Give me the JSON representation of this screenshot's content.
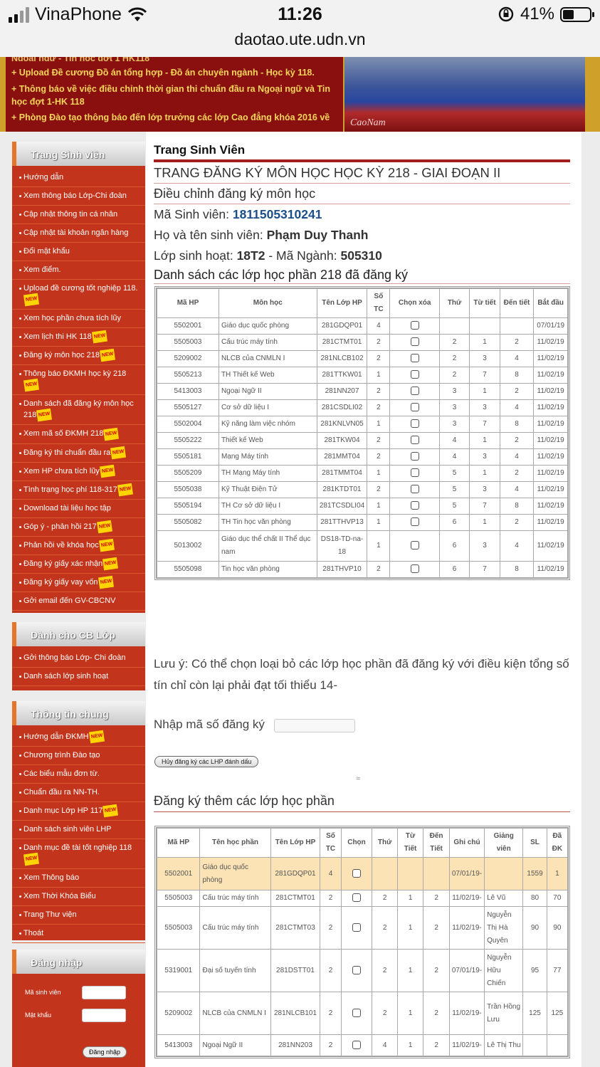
{
  "status": {
    "carrier": "VinaPhone",
    "time": "11:26",
    "battery": "41%",
    "battery_level": 0.41,
    "url": "daotao.ute.udn.vn"
  },
  "banner": {
    "news": [
      "Ngoại ngữ - Tin học đợt 1 HK118",
      "+ Upload Đề cương Đồ án tổng hợp - Đồ án chuyên ngành - Học kỳ 118.",
      "+ Thông báo về việc điều chỉnh thời gian thi chuẩn đầu ra Ngoại ngữ và Tin học đợt 1-HK 118",
      "+ Phòng Đào tạo thông báo đến lớp trưởng các lớp Cao đẳng khóa 2016 về"
    ],
    "signature": "CaoNam"
  },
  "sidebar": {
    "student": {
      "title": "Trang Sinh viên",
      "items": [
        {
          "label": "Hướng dẫn",
          "new": ""
        },
        {
          "label": "Xem thông báo Lớp-Chi đoàn",
          "new": ""
        },
        {
          "label": "Cập nhật thông tin cá nhân",
          "new": ""
        },
        {
          "label": "Cập nhật tài khoản ngân hàng",
          "new": ""
        },
        {
          "label": "Đổi mật khẩu",
          "new": ""
        },
        {
          "label": "Xem điểm.",
          "new": ""
        },
        {
          "label": "Upload đề cương tốt nghiệp 118.",
          "new": "NEW"
        },
        {
          "label": "Xem học phần chưa tích lũy",
          "new": ""
        },
        {
          "label": "Xem lịch thi HK 118",
          "new": "NEW"
        },
        {
          "label": "Đăng ký môn học 218",
          "new": "NEW"
        },
        {
          "label": "Thông báo ĐKMH học kỳ 218",
          "new": "NEW"
        },
        {
          "label": "Danh sách đã đăng ký môn học 218",
          "new": "NEW"
        },
        {
          "label": "Xem mã số ĐKMH 218",
          "new": "NEW"
        },
        {
          "label": "Đăng ký thi chuẩn đầu ra",
          "new": "NEW"
        },
        {
          "label": "Xem HP chưa tích lũy",
          "new": "NEW"
        },
        {
          "label": "Tình trạng học phí 118-317",
          "new": "NEW"
        },
        {
          "label": "Download tài liệu học tập",
          "new": ""
        },
        {
          "label": "Góp ý - phản hồi 217",
          "new": "NEW"
        },
        {
          "label": "Phản hồi về khóa học",
          "new": "NEW"
        },
        {
          "label": "Đăng ký giấy xác nhận",
          "new": "NEW"
        },
        {
          "label": "Đăng ký giấy vay vốn",
          "new": "NEW"
        },
        {
          "label": "Gởi email đến GV-CBCNV",
          "new": ""
        }
      ]
    },
    "cb": {
      "title": "Dành cho CB Lớp",
      "items": [
        {
          "label": "Gởi thông báo Lớp- Chi đoàn",
          "new": ""
        },
        {
          "label": "Danh sách lớp sinh hoạt",
          "new": ""
        }
      ]
    },
    "general": {
      "title": "Thông tin chung",
      "items": [
        {
          "label": "Hướng dẫn ĐKMH",
          "new": "NEW"
        },
        {
          "label": "Chương trình Đào tạo",
          "new": ""
        },
        {
          "label": "Các biểu mẫu đơn từ.",
          "new": ""
        },
        {
          "label": "Chuẩn đầu ra NN-TH.",
          "new": ""
        },
        {
          "label": "Danh mục Lớp HP 117",
          "new": "NEW"
        },
        {
          "label": "Danh sách sinh viên LHP",
          "new": ""
        },
        {
          "label": "Danh mục đề tài tốt nghiệp 118",
          "new": "NEW"
        },
        {
          "label": "Xem Thông báo",
          "new": ""
        },
        {
          "label": "Xem Thời Khóa Biểu",
          "new": ""
        },
        {
          "label": "Trang Thư viện",
          "new": ""
        },
        {
          "label": "Thoát",
          "new": ""
        }
      ]
    },
    "login": {
      "title": "Đăng nhập",
      "id_label": "Mã sinh viên",
      "pw_label": "Mật khẩu",
      "button": "Đăng nhập"
    }
  },
  "main": {
    "title": "Trang Sinh Viên",
    "subtitle": "TRANG ĐĂNG KÝ MÔN HỌC HỌC KỲ 218 - GIAI ĐOẠN II",
    "section": "Điều chỉnh đăng ký môn học",
    "student_id_label": "Mã Sinh viên: ",
    "student_id": "1811505310241",
    "name_label": "Họ và tên sinh viên: ",
    "name": "Phạm Duy Thanh",
    "class_label": "Lớp sinh hoạt: ",
    "class": "18T2",
    "major_sep": " - Mã Ngành: ",
    "major": "505310",
    "registered_title": "Danh sách các lớp học phần 218 đã đăng ký",
    "registered_headers": [
      "Mã HP",
      "Môn học",
      "Tên Lớp HP",
      "Số TC",
      "Chọn xóa",
      "Thứ",
      "Từ tiết",
      "Đến tiết",
      "Bắt đầu"
    ],
    "registered_rows": [
      [
        "5502001",
        "Giáo dục quốc phòng",
        "281GDQP01",
        "4",
        "",
        "",
        "",
        "",
        "07/01/19"
      ],
      [
        "5505003",
        "Cấu trúc máy tính",
        "281CTMT01",
        "2",
        "",
        "2",
        "1",
        "2",
        "11/02/19"
      ],
      [
        "5209002",
        "NLCB của CNMLN I",
        "281NLCB102",
        "2",
        "",
        "2",
        "3",
        "4",
        "11/02/19"
      ],
      [
        "5505213",
        "TH Thiết kế Web",
        "281TTKW01",
        "1",
        "",
        "2",
        "7",
        "8",
        "11/02/19"
      ],
      [
        "5413003",
        "Ngoại Ngữ II",
        "281NN207",
        "2",
        "",
        "3",
        "1",
        "2",
        "11/02/19"
      ],
      [
        "5505127",
        "Cơ sở dữ liệu I",
        "281CSDLI02",
        "2",
        "",
        "3",
        "3",
        "4",
        "11/02/19"
      ],
      [
        "5502004",
        "Kỹ năng làm việc nhóm",
        "281KNLVN05",
        "1",
        "",
        "3",
        "7",
        "8",
        "11/02/19"
      ],
      [
        "5505222",
        "Thiết kế Web",
        "281TKW04",
        "2",
        "",
        "4",
        "1",
        "2",
        "11/02/19"
      ],
      [
        "5505181",
        "Mạng Máy tính",
        "281MMT04",
        "2",
        "",
        "4",
        "3",
        "4",
        "11/02/19"
      ],
      [
        "5505209",
        "TH Mạng Máy tính",
        "281TMMT04",
        "1",
        "",
        "5",
        "1",
        "2",
        "11/02/19"
      ],
      [
        "5505038",
        "Kỹ Thuật Điện Tử",
        "281KTDT01",
        "2",
        "",
        "5",
        "3",
        "4",
        "11/02/19"
      ],
      [
        "5505194",
        "TH Cơ sở dữ liệu I",
        "281TCSDLI04",
        "1",
        "",
        "5",
        "7",
        "8",
        "11/02/19"
      ],
      [
        "5505082",
        "TH Tin học văn phòng",
        "281TTHVP13",
        "1",
        "",
        "6",
        "1",
        "2",
        "11/02/19"
      ],
      [
        "5013002",
        "Giáo dục thể chất II Thể dục nam",
        "DS18-TD-na-18",
        "1",
        "",
        "6",
        "3",
        "4",
        "11/02/19"
      ],
      [
        "5505098",
        "Tin học văn phòng",
        "281THVP10",
        "2",
        "",
        "6",
        "7",
        "8",
        "11/02/19"
      ]
    ],
    "note": "Lưu ý: Có thể chọn loại bỏ các lớp học phần đã đăng ký với điều kiện tổng số tín chỉ còn lại phải đạt tối thiểu 14-",
    "enter_label": "Nhập mã số đăng ký",
    "cancel_button": "Hủy đăng ký các LHP đánh dấu",
    "add_title": "Đăng ký thêm các lớp học phần",
    "add_headers": [
      "Mã HP",
      "Tên học phần",
      "Tên Lớp HP",
      "Số TC",
      "Chọn",
      "Thứ",
      "Từ Tiết",
      "Đến Tiết",
      "Ghi chú",
      "Giảng viên",
      "SL",
      "Đã ĐK"
    ],
    "add_rows": [
      [
        "5502001",
        "Giáo dục quốc phòng",
        "281GDQP01",
        "4",
        "",
        "",
        "",
        "",
        "07/01/19-",
        "",
        "1559",
        "1"
      ],
      [
        "5505003",
        "Cấu trúc máy tính",
        "281CTMT01",
        "2",
        "",
        "2",
        "1",
        "2",
        "11/02/19-",
        "Lê Vũ",
        "80",
        "70"
      ],
      [
        "5505003",
        "Cấu trúc máy tính",
        "281CTMT03",
        "2",
        "",
        "2",
        "1",
        "2",
        "11/02/19-",
        "Nguyễn Thị Hà Quyên",
        "90",
        "90"
      ],
      [
        "5319001",
        "Đại số tuyến tính",
        "281DSTT01",
        "2",
        "",
        "2",
        "1",
        "2",
        "07/01/19-",
        "Nguyễn Hữu Chiến",
        "95",
        "77"
      ],
      [
        "5209002",
        "NLCB của CNMLN I",
        "281NLCB101",
        "2",
        "",
        "2",
        "1",
        "2",
        "11/02/19-",
        "Trần Hồng Lưu",
        "125",
        "125"
      ],
      [
        "5413003",
        "Ngoại Ngữ II",
        "281NN203",
        "2",
        "",
        "4",
        "1",
        "2",
        "11/02/19-",
        "Lê Thị Thu",
        "",
        ""
      ]
    ]
  }
}
